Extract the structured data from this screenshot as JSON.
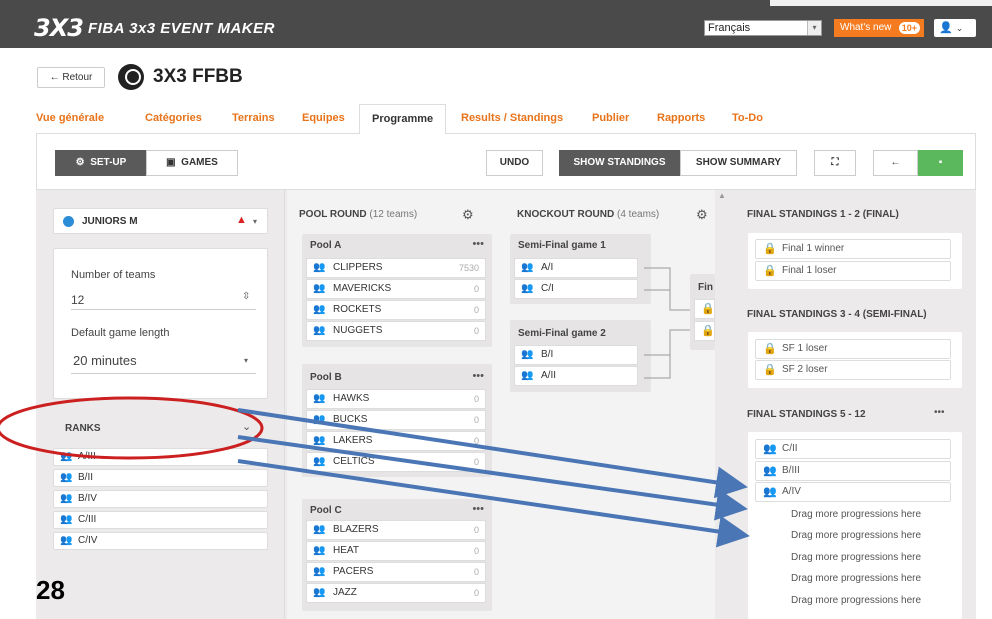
{
  "app": {
    "logo": "3X3",
    "title": "FIBA 3x3 EVENT MAKER",
    "language": "Français",
    "whats_new": "What's new",
    "whats_new_count": "10+"
  },
  "header": {
    "back_label": "← Retour",
    "event_name": "3X3 FFBB"
  },
  "tabs": [
    {
      "label": "Vue générale"
    },
    {
      "label": "Catégories"
    },
    {
      "label": "Terrains"
    },
    {
      "label": "Equipes"
    },
    {
      "label": "Programme"
    },
    {
      "label": "Results / Standings"
    },
    {
      "label": "Publier"
    },
    {
      "label": "Rapports"
    },
    {
      "label": "To-Do"
    }
  ],
  "toolbar": {
    "setup": "SET-UP",
    "games": "GAMES",
    "undo": "UNDO",
    "show_standings": "SHOW STANDINGS",
    "show_summary": "SHOW SUMMARY"
  },
  "left": {
    "category": "JUNIORS M",
    "number_of_teams_label": "Number of teams",
    "number_of_teams": "12",
    "game_length_label": "Default game length",
    "game_length": "20 minutes",
    "ranks_label": "RANKS",
    "ranks": [
      "A/III",
      "B/II",
      "B/IV",
      "C/III",
      "C/IV"
    ]
  },
  "pool_round": {
    "title": "POOL ROUND",
    "subtitle": "(12 teams)",
    "pools": [
      {
        "name": "Pool A",
        "teams": [
          {
            "n": "CLIPPERS",
            "v": "7530"
          },
          {
            "n": "MAVERICKS",
            "v": "0"
          },
          {
            "n": "ROCKETS",
            "v": "0"
          },
          {
            "n": "NUGGETS",
            "v": "0"
          }
        ]
      },
      {
        "name": "Pool B",
        "teams": [
          {
            "n": "HAWKS",
            "v": "0"
          },
          {
            "n": "BUCKS",
            "v": "0"
          },
          {
            "n": "LAKERS",
            "v": "0"
          },
          {
            "n": "CELTICS",
            "v": "0"
          }
        ]
      },
      {
        "name": "Pool C",
        "teams": [
          {
            "n": "BLAZERS",
            "v": "0"
          },
          {
            "n": "HEAT",
            "v": "0"
          },
          {
            "n": "PACERS",
            "v": "0"
          },
          {
            "n": "JAZZ",
            "v": "0"
          }
        ]
      }
    ]
  },
  "knockout": {
    "title": "KNOCKOUT ROUND",
    "subtitle": "(4 teams)",
    "games": [
      {
        "name": "Semi-Final game 1",
        "slots": [
          "A/I",
          "C/I"
        ]
      },
      {
        "name": "Semi-Final game 2",
        "slots": [
          "B/I",
          "A/II"
        ]
      }
    ],
    "final_label": "Fin"
  },
  "standings": {
    "s1_title": "FINAL STANDINGS 1 - 2 (FINAL)",
    "s1_items": [
      "Final 1 winner",
      "Final 1 loser"
    ],
    "s2_title": "FINAL STANDINGS 3 - 4 (SEMI-FINAL)",
    "s2_items": [
      "SF 1 loser",
      "SF 2 loser"
    ],
    "s3_title": "FINAL STANDINGS 5 - 12",
    "s3_items": [
      "C/II",
      "B/III",
      "A/IV"
    ],
    "drag_label": "Drag more progressions here"
  },
  "slide_number": "28",
  "colors": {
    "accent": "#e8731a",
    "blue": "#2b8cd8",
    "arrow": "#4a76b5",
    "highlight": "#cc1f1f"
  }
}
